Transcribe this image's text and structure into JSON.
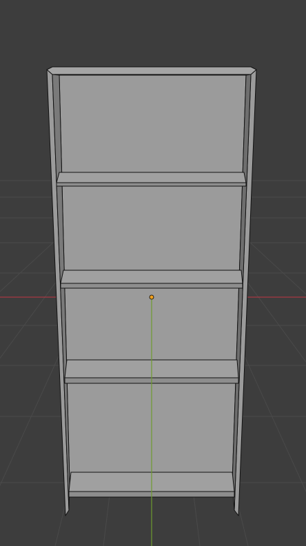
{
  "app": {
    "name": "",
    "view": "3d-viewport"
  },
  "viewport": {
    "background_color": "#3d3d3d",
    "grid_color": "#4a4a4a",
    "x_axis_color": "#a83a44",
    "y_axis_color": "#6f9b2e",
    "object_color": "#9b9b9b",
    "edge_color": "#111111",
    "origin_color": "#f0a020"
  },
  "scene": {
    "object": "bookshelf",
    "shelf_count": 5,
    "selected": false
  },
  "icons": {
    "origin": "object-origin-dot"
  }
}
